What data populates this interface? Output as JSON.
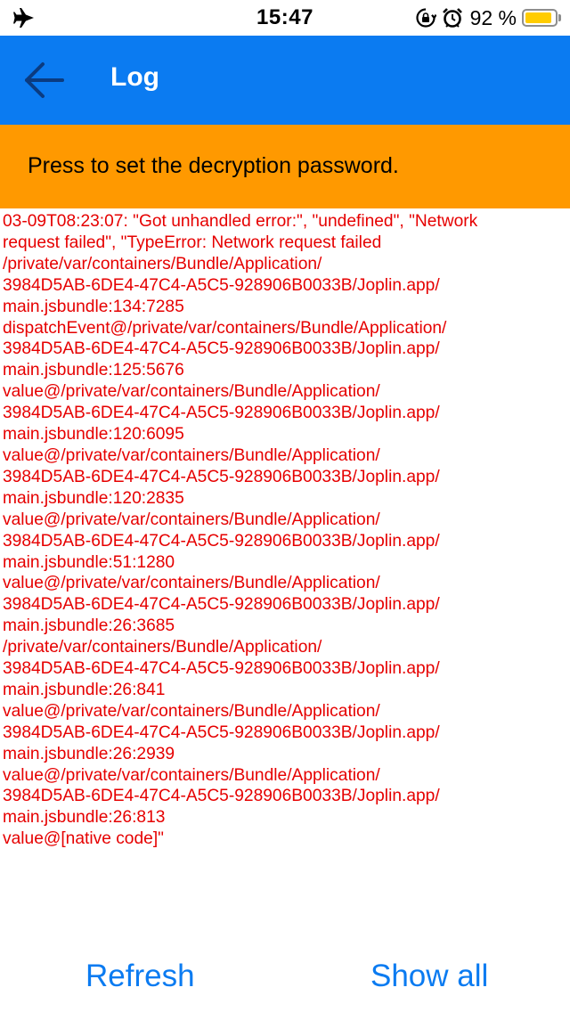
{
  "status_bar": {
    "time": "15:47",
    "battery_percent": "92 %",
    "battery_level": 0.92,
    "icons": [
      "airplane-icon",
      "rotation-lock-icon",
      "alarm-icon",
      "battery-icon"
    ]
  },
  "header": {
    "title": "Log",
    "background_color": "#0b7bf1"
  },
  "banner": {
    "text": "Press to set the decryption password.",
    "background_color": "#ff9900"
  },
  "log": {
    "color": "#e60000",
    "lines": [
      "03-09T08:23:07: \"Got unhandled error:\", \"undefined\", \"Network",
      "request failed\", \"TypeError: Network request failed",
      "/private/var/containers/Bundle/Application/",
      "3984D5AB-6DE4-47C4-A5C5-928906B0033B/Joplin.app/",
      "main.jsbundle:134:7285",
      "dispatchEvent@/private/var/containers/Bundle/Application/",
      "3984D5AB-6DE4-47C4-A5C5-928906B0033B/Joplin.app/",
      "main.jsbundle:125:5676",
      "value@/private/var/containers/Bundle/Application/",
      "3984D5AB-6DE4-47C4-A5C5-928906B0033B/Joplin.app/",
      "main.jsbundle:120:6095",
      "value@/private/var/containers/Bundle/Application/",
      "3984D5AB-6DE4-47C4-A5C5-928906B0033B/Joplin.app/",
      "main.jsbundle:120:2835",
      "value@/private/var/containers/Bundle/Application/",
      "3984D5AB-6DE4-47C4-A5C5-928906B0033B/Joplin.app/",
      "main.jsbundle:51:1280",
      "value@/private/var/containers/Bundle/Application/",
      "3984D5AB-6DE4-47C4-A5C5-928906B0033B/Joplin.app/",
      "main.jsbundle:26:3685",
      "/private/var/containers/Bundle/Application/",
      "3984D5AB-6DE4-47C4-A5C5-928906B0033B/Joplin.app/",
      "main.jsbundle:26:841",
      "value@/private/var/containers/Bundle/Application/",
      "3984D5AB-6DE4-47C4-A5C5-928906B0033B/Joplin.app/",
      "main.jsbundle:26:2939",
      "value@/private/var/containers/Bundle/Application/",
      "3984D5AB-6DE4-47C4-A5C5-928906B0033B/Joplin.app/",
      "main.jsbundle:26:813",
      "value@[native code]\""
    ]
  },
  "footer": {
    "refresh_label": "Refresh",
    "show_all_label": "Show all"
  }
}
